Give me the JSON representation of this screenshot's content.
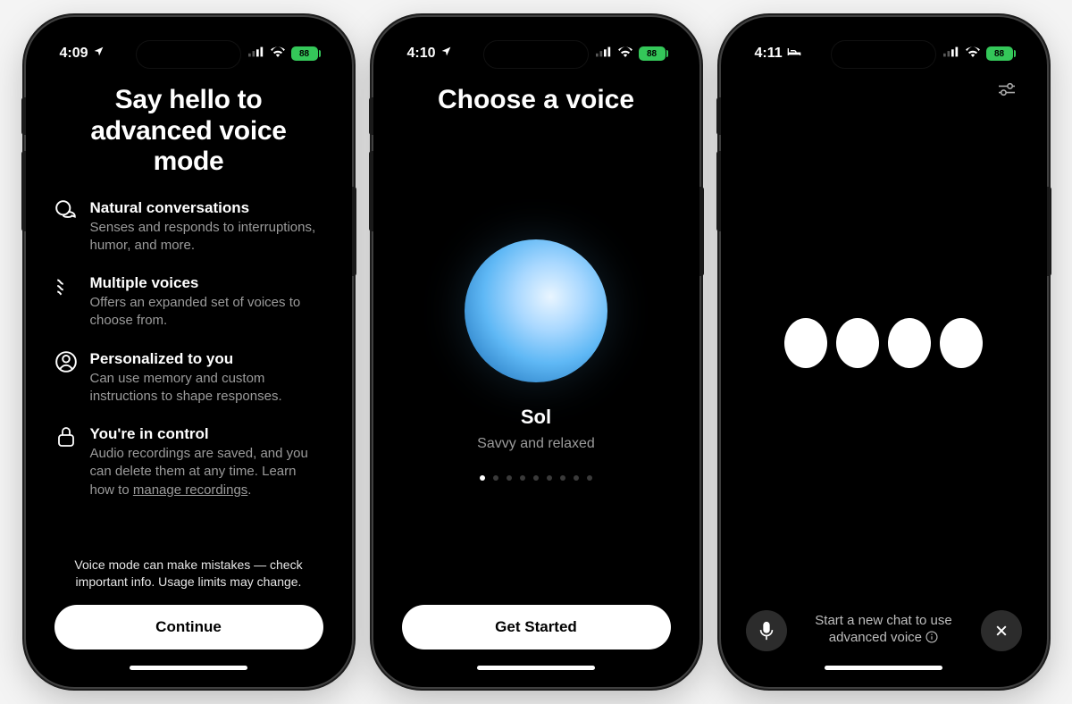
{
  "phones": {
    "one": {
      "status": {
        "time": "4:09",
        "battery": "88",
        "status_icon": "location-arrow"
      },
      "title": "Say hello to advanced voice mode",
      "features": [
        {
          "icon": "chat-icon",
          "title": "Natural conversations",
          "desc": "Senses and responds to interruptions, humor, and more."
        },
        {
          "icon": "waves-icon",
          "title": "Multiple voices",
          "desc": "Offers an expanded set of voices to choose from."
        },
        {
          "icon": "person-icon",
          "title": "Personalized to you",
          "desc": "Can use memory and custom instructions to shape responses."
        },
        {
          "icon": "lock-icon",
          "title": "You're in control",
          "desc": "Audio recordings are saved, and you can delete them at any time. Learn how to ",
          "link": "manage recordings"
        }
      ],
      "note": "Voice mode can make mistakes — check important info. Usage limits may change.",
      "cta": "Continue"
    },
    "two": {
      "status": {
        "time": "4:10",
        "battery": "88",
        "status_icon": "location-arrow"
      },
      "title": "Choose a voice",
      "voice": {
        "name": "Sol",
        "tagline": "Savvy and relaxed"
      },
      "page_count": 9,
      "active_page": 0,
      "cta": "Get Started"
    },
    "three": {
      "status": {
        "time": "4:11",
        "battery": "88",
        "status_icon": "bed"
      },
      "message": "Start a new chat to use advanced voice"
    }
  }
}
